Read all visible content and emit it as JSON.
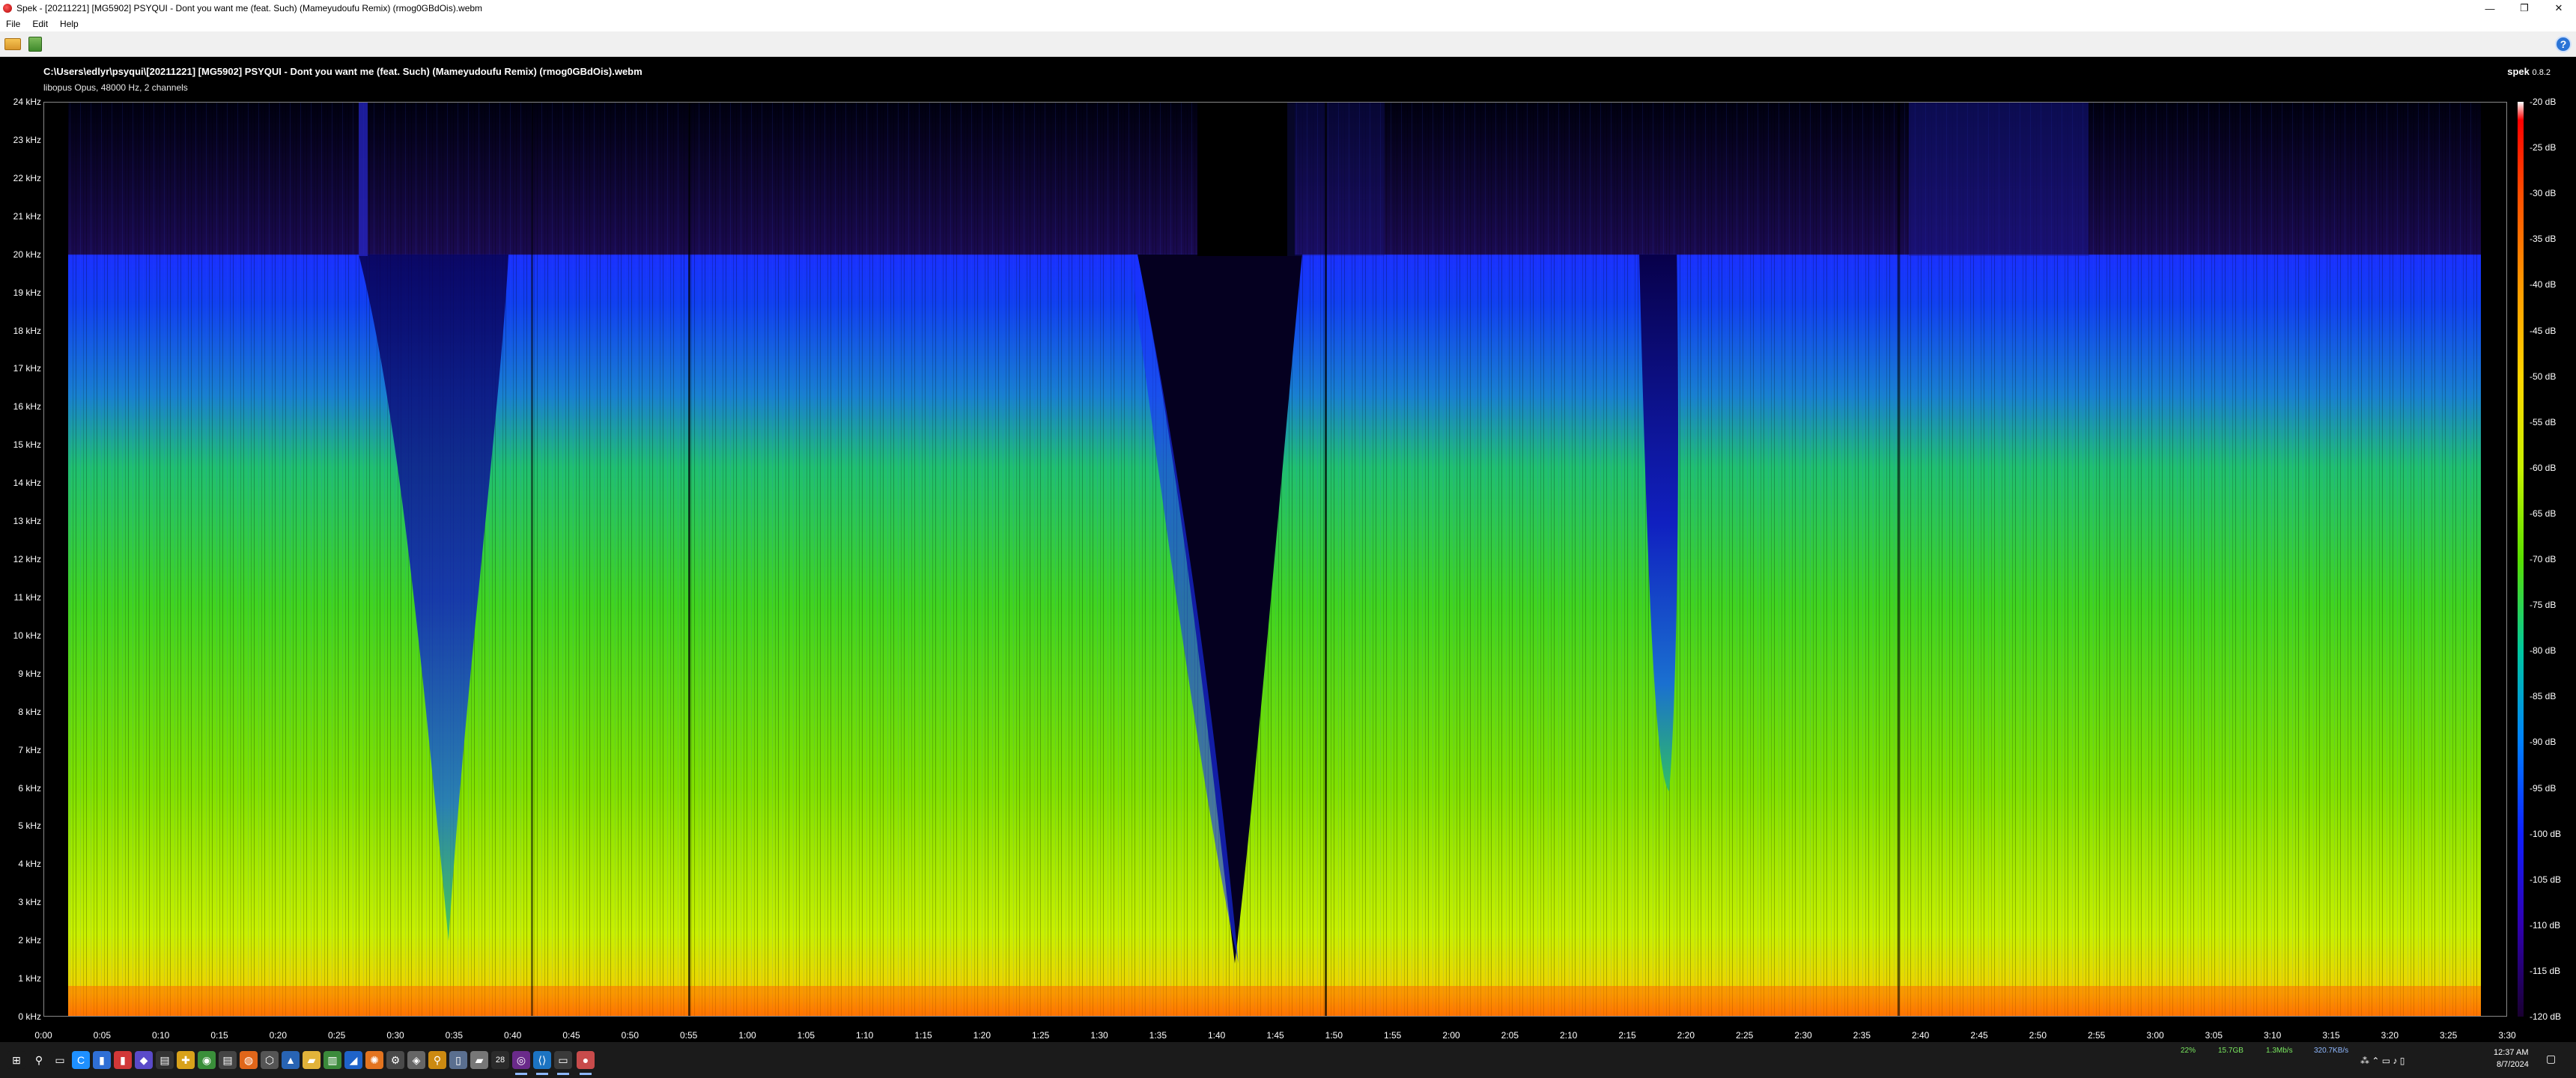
{
  "window": {
    "title": "Spek - [20211221] [MG5902] PSYQUI - Dont you want me (feat. Such) (Mameyudoufu Remix) (rmog0GBdOis).webm",
    "minimize_label": "—",
    "restore_label": "❐",
    "close_label": "✕"
  },
  "menu": {
    "items": [
      "File",
      "Edit",
      "Help"
    ]
  },
  "toolbar": {
    "open_icon": "folder-open-icon",
    "save_icon": "save-icon",
    "about_label": "?"
  },
  "spectrogram": {
    "file_path": "C:\\Users\\edlyr\\psyqui\\[20211221] [MG5902] PSYQUI - Dont you want me (feat. Such) (Mameyudoufu Remix) (rmog0GBdOis).webm",
    "file_info": "libopus Opus, 48000 Hz, 2 channels",
    "brand_name": "spek",
    "brand_version": "0.8.2",
    "freq_labels": [
      "24 kHz",
      "23 kHz",
      "22 kHz",
      "21 kHz",
      "20 kHz",
      "19 kHz",
      "18 kHz",
      "17 kHz",
      "16 kHz",
      "15 kHz",
      "14 kHz",
      "13 kHz",
      "12 kHz",
      "11 kHz",
      "10 kHz",
      "9 kHz",
      "8 kHz",
      "7 kHz",
      "6 kHz",
      "5 kHz",
      "4 kHz",
      "3 kHz",
      "2 kHz",
      "1 kHz",
      "0 kHz"
    ],
    "time_labels": [
      "0:00",
      "0:05",
      "0:10",
      "0:15",
      "0:20",
      "0:25",
      "0:30",
      "0:35",
      "0:40",
      "0:45",
      "0:50",
      "0:55",
      "1:00",
      "1:05",
      "1:10",
      "1:15",
      "1:20",
      "1:25",
      "1:30",
      "1:35",
      "1:40",
      "1:45",
      "1:50",
      "1:55",
      "2:00",
      "2:05",
      "2:10",
      "2:15",
      "2:20",
      "2:25",
      "2:30",
      "2:35",
      "2:40",
      "2:45",
      "2:50",
      "2:55",
      "3:00",
      "3:05",
      "3:10",
      "3:15",
      "3:20",
      "3:25",
      "3:30"
    ],
    "db_labels": [
      "-20 dB",
      "-25 dB",
      "-30 dB",
      "-35 dB",
      "-40 dB",
      "-45 dB",
      "-50 dB",
      "-55 dB",
      "-60 dB",
      "-65 dB",
      "-70 dB",
      "-75 dB",
      "-80 dB",
      "-85 dB",
      "-90 dB",
      "-95 dB",
      "-100 dB",
      "-105 dB",
      "-110 dB",
      "-115 dB",
      "-120 dB"
    ],
    "freq_max_khz": 24,
    "duration_s": 210,
    "cutoff_khz": 20
  },
  "taskbar": {
    "apps": [
      {
        "name": "windows-start-icon",
        "glyph": "⊞",
        "color": "#1b1b1b"
      },
      {
        "name": "search-icon",
        "glyph": "⚲",
        "color": "#1b1b1b"
      },
      {
        "name": "task-view-icon",
        "glyph": "▭",
        "color": "#1b1b1b"
      },
      {
        "name": "app-icon-c",
        "glyph": "C",
        "color": "#1e90ff"
      },
      {
        "name": "app-icon-blue",
        "glyph": "▮",
        "color": "#2f6fd6"
      },
      {
        "name": "app-icon-red",
        "glyph": "▮",
        "color": "#d13838"
      },
      {
        "name": "app-icon-purple",
        "glyph": "◆",
        "color": "#5a4ac9"
      },
      {
        "name": "terminal-icon",
        "glyph": "▤",
        "color": "#333333"
      },
      {
        "name": "app-icon-yellow",
        "glyph": "✚",
        "color": "#d9a21b"
      },
      {
        "name": "chrome-icon",
        "glyph": "◉",
        "color": "#3a8f3a"
      },
      {
        "name": "terminal2-icon",
        "glyph": "▤",
        "color": "#444444"
      },
      {
        "name": "firefox-icon",
        "glyph": "◍",
        "color": "#e0661a"
      },
      {
        "name": "cube-icon",
        "glyph": "⬡",
        "color": "#555555"
      },
      {
        "name": "app-icon-blue2",
        "glyph": "▲",
        "color": "#2864b4"
      },
      {
        "name": "explorer-icon",
        "glyph": "▰",
        "color": "#e2b33a"
      },
      {
        "name": "notes-icon",
        "glyph": "▥",
        "color": "#3b8b3b"
      },
      {
        "name": "app-icon-shark",
        "glyph": "◢",
        "color": "#1f63c9"
      },
      {
        "name": "app-icon-orange",
        "glyph": "✺",
        "color": "#e3741f"
      },
      {
        "name": "settings-icon",
        "glyph": "⚙",
        "color": "#4a4a4a"
      },
      {
        "name": "app-icon-grey",
        "glyph": "◈",
        "color": "#666666"
      },
      {
        "name": "search2-icon",
        "glyph": "⚲",
        "color": "#cc8a11"
      },
      {
        "name": "document-icon",
        "glyph": "▯",
        "color": "#5a6f8f"
      },
      {
        "name": "app-icon-grey2",
        "glyph": "▰",
        "color": "#777777"
      },
      {
        "name": "app-icon-28",
        "glyph": "28",
        "color": "#2b2b2b"
      },
      {
        "name": "media-icon",
        "glyph": "◎",
        "color": "#6a2a8a"
      },
      {
        "name": "vscode-icon",
        "glyph": "⟨⟩",
        "color": "#1c74c2"
      },
      {
        "name": "window-icon",
        "glyph": "▭",
        "color": "#3a3a3a"
      },
      {
        "name": "spek-icon",
        "glyph": "●",
        "color": "#c84b4b"
      }
    ],
    "meters": [
      "22%",
      "15.7GB",
      "1.3Mb/s",
      "320.7KB/s"
    ],
    "time": "12:37 AM",
    "date": "8/7/2024"
  }
}
